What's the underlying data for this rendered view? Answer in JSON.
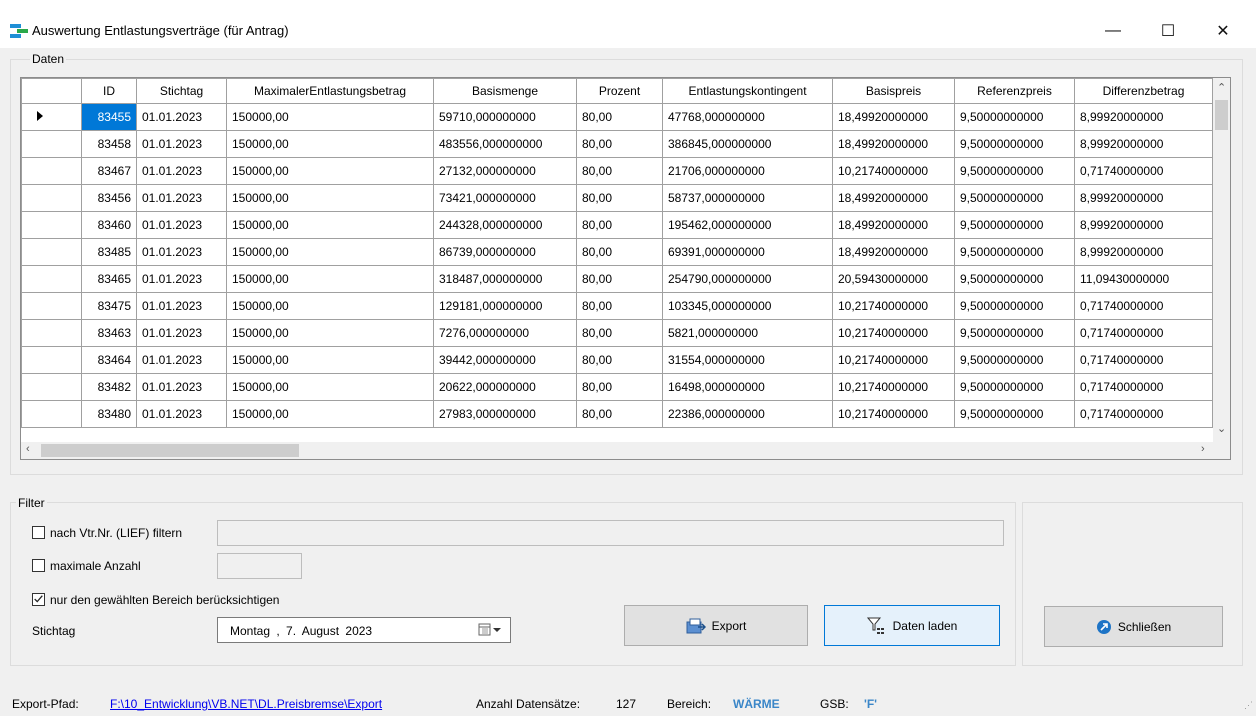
{
  "window": {
    "title": "Auswertung Entlastungsverträge (für Antrag)"
  },
  "groups": {
    "daten_label": "Daten",
    "filter_label": "Filter"
  },
  "table": {
    "columns": [
      "ID",
      "Stichtag",
      "MaximalerEntlastungsbetrag",
      "Basismenge",
      "Prozent",
      "Entlastungskontingent",
      "Basispreis",
      "Referenzpreis",
      "Differenzbetrag"
    ],
    "rows": [
      [
        "83455",
        "01.01.2023",
        "150000,00",
        "59710,000000000",
        "80,00",
        "47768,000000000",
        "18,49920000000",
        "9,50000000000",
        "8,99920000000"
      ],
      [
        "83458",
        "01.01.2023",
        "150000,00",
        "483556,000000000",
        "80,00",
        "386845,000000000",
        "18,49920000000",
        "9,50000000000",
        "8,99920000000"
      ],
      [
        "83467",
        "01.01.2023",
        "150000,00",
        "27132,000000000",
        "80,00",
        "21706,000000000",
        "10,21740000000",
        "9,50000000000",
        "0,71740000000"
      ],
      [
        "83456",
        "01.01.2023",
        "150000,00",
        "73421,000000000",
        "80,00",
        "58737,000000000",
        "18,49920000000",
        "9,50000000000",
        "8,99920000000"
      ],
      [
        "83460",
        "01.01.2023",
        "150000,00",
        "244328,000000000",
        "80,00",
        "195462,000000000",
        "18,49920000000",
        "9,50000000000",
        "8,99920000000"
      ],
      [
        "83485",
        "01.01.2023",
        "150000,00",
        "86739,000000000",
        "80,00",
        "69391,000000000",
        "18,49920000000",
        "9,50000000000",
        "8,99920000000"
      ],
      [
        "83465",
        "01.01.2023",
        "150000,00",
        "318487,000000000",
        "80,00",
        "254790,000000000",
        "20,59430000000",
        "9,50000000000",
        "11,09430000000"
      ],
      [
        "83475",
        "01.01.2023",
        "150000,00",
        "129181,000000000",
        "80,00",
        "103345,000000000",
        "10,21740000000",
        "9,50000000000",
        "0,71740000000"
      ],
      [
        "83463",
        "01.01.2023",
        "150000,00",
        "7276,000000000",
        "80,00",
        "5821,000000000",
        "10,21740000000",
        "9,50000000000",
        "0,71740000000"
      ],
      [
        "83464",
        "01.01.2023",
        "150000,00",
        "39442,000000000",
        "80,00",
        "31554,000000000",
        "10,21740000000",
        "9,50000000000",
        "0,71740000000"
      ],
      [
        "83482",
        "01.01.2023",
        "150000,00",
        "20622,000000000",
        "80,00",
        "16498,000000000",
        "10,21740000000",
        "9,50000000000",
        "0,71740000000"
      ],
      [
        "83480",
        "01.01.2023",
        "150000,00",
        "27983,000000000",
        "80,00",
        "22386,000000000",
        "10,21740000000",
        "9,50000000000",
        "0,71740000000"
      ]
    ]
  },
  "filter": {
    "vtr_label": "nach Vtr.Nr. (LIEF) filtern",
    "vtr_checked": false,
    "vtr_value": "",
    "max_label": "maximale Anzahl",
    "max_checked": false,
    "max_value": "",
    "bereich_label": "nur den gewählten Bereich berücksichtigen",
    "bereich_checked": true,
    "stichtag_label": "Stichtag",
    "stichtag_value": "Montag  ,   7.   August   2023"
  },
  "buttons": {
    "export": "Export",
    "laden": "Daten laden",
    "close": "Schließen"
  },
  "status": {
    "path_label": "Export-Pfad:",
    "path_value": "F:\\10_Entwicklung\\VB.NET\\DL.Preisbremse\\Export",
    "count_label": "Anzahl Datensätze:",
    "count_value": "127",
    "bereich_label": "Bereich:",
    "bereich_value": "WÄRME",
    "gsb_label": "GSB:",
    "gsb_value": "'F'"
  },
  "colors": {
    "accent": "#0078d7",
    "bereich": "#3a86c8",
    "gsb": "#3a86c8"
  }
}
